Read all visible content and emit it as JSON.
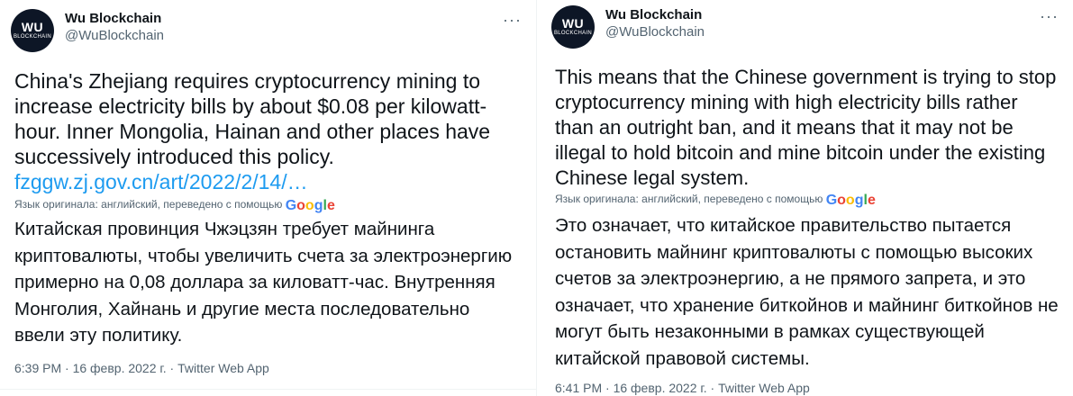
{
  "tweets": [
    {
      "author": {
        "name": "Wu Blockchain",
        "handle": "@WuBlockchain",
        "avatar_top": "WU",
        "avatar_bottom": "BLOCKCHAIN"
      },
      "more": "···",
      "text": "China's Zhejiang requires cryptocurrency mining to increase electricity bills by about $0.08 per kilowatt-hour. Inner Mongolia, Hainan and other places have successively introduced this policy.",
      "link": "fzggw.zj.gov.cn/art/2022/2/14/…",
      "translation_note": "Язык оригинала: английский, переведено с помощью",
      "translated": "Китайская провинция Чжэцзян требует майнинга криптовалюты, чтобы увеличить счета за электроэнергию примерно на 0,08 доллара за киловатт-час. Внутренняя Монголия, Хайнань и другие места последовательно ввели эту политику.",
      "time": "6:39 PM · 16 февр. 2022 г. · ",
      "client": "Twitter Web App"
    },
    {
      "author": {
        "name": "Wu Blockchain",
        "handle": "@WuBlockchain",
        "avatar_top": "WU",
        "avatar_bottom": "BLOCKCHAIN"
      },
      "more": "···",
      "text": "This means that the Chinese government is trying to stop cryptocurrency mining with high electricity bills rather than an outright ban, and it means that it may not be illegal to hold bitcoin and mine bitcoin under the existing Chinese legal system.",
      "translation_note": "Язык оригинала: английский, переведено с помощью",
      "translated": "Это означает, что китайское правительство пытается остановить майнинг криптовалюты с помощью высоких счетов за электроэнергию, а не прямого запрета, и это означает, что хранение биткойнов и майнинг биткойнов не могут быть незаконными в рамках существующей китайской правовой системы.",
      "time": "6:41 PM · 16 февр. 2022 г. · ",
      "client": "Twitter Web App"
    }
  ],
  "brand": {
    "google": [
      "G",
      "o",
      "o",
      "g",
      "l",
      "e"
    ]
  },
  "colors": {
    "link": "#1d9bf0",
    "text": "#0f1419",
    "secondary": "#536471"
  }
}
